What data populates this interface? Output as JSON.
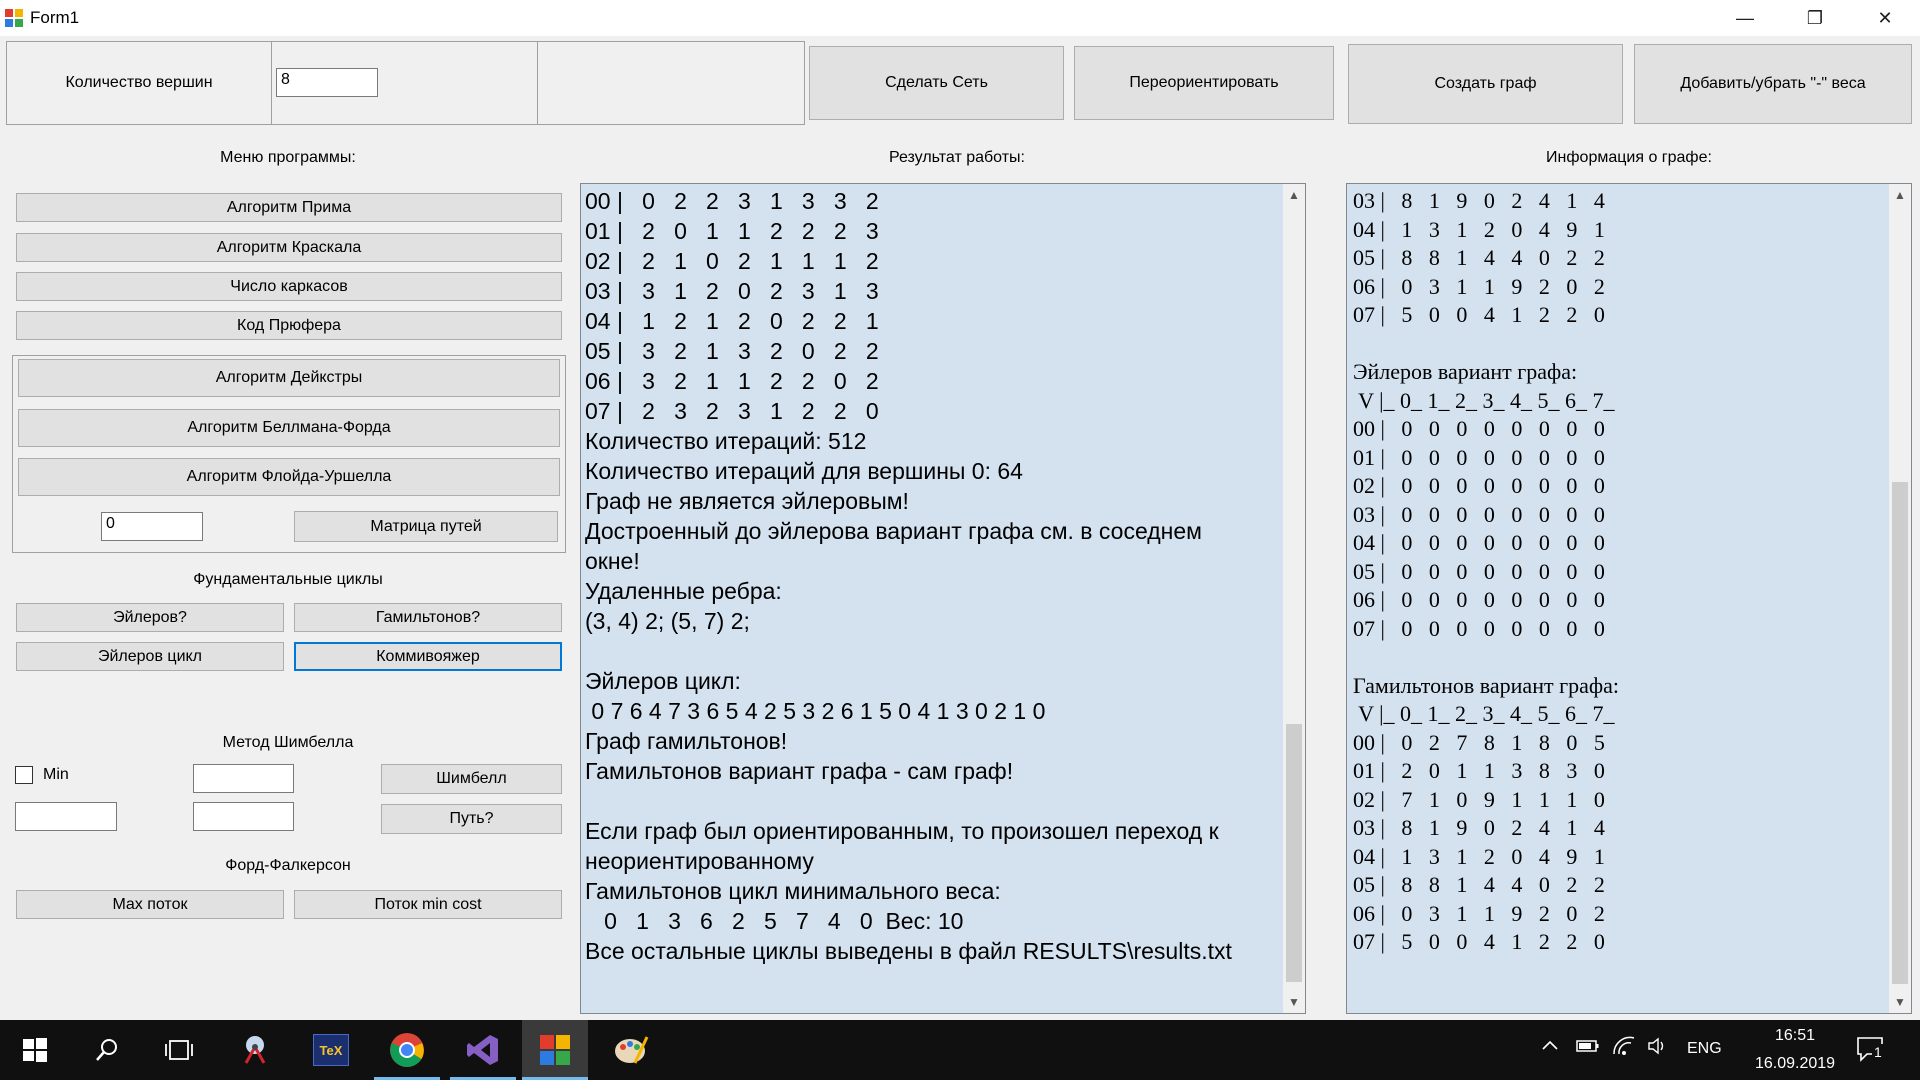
{
  "window": {
    "title": "Form1",
    "minimize": "—",
    "restore": "❐",
    "close": "✕"
  },
  "top": {
    "vertex_count_label": "Количество вершин",
    "vertex_count_value": "8",
    "make_network": "Сделать Сеть",
    "reorient": "Переориентировать",
    "create_graph": "Создать граф",
    "toggle_weights": "Добавить/убрать \"-\" веса"
  },
  "menu": {
    "title": "Меню программы:",
    "prim": "Алгоритм Прима",
    "kruskal": "Алгоритм Краскала",
    "frames": "Число каркасов",
    "prufer": "Код Прюфера",
    "dijkstra": "Алгоритм Дейкстры",
    "bellman": "Алгоритм Беллмана-Форда",
    "floyd": "Алгоритм Флойда-Уршелла",
    "path_input": "0",
    "path_matrix": "Матрица путей",
    "fund_title": "Фундаментальные циклы",
    "euler_q": "Эйлеров?",
    "hamilton_q": "Гамильтонов?",
    "euler_cycle": "Эйлеров цикл",
    "salesman": "Коммивояжер",
    "shimbel_title": "Метод Шимбелла",
    "min_label": "Min",
    "shimbel": "Шимбелл",
    "path_q": "Путь?",
    "ford_title": "Форд-Фалкерсон",
    "max_flow": "Max поток",
    "min_cost": "Поток min cost"
  },
  "result": {
    "title": "Результат работы:",
    "lines": [
      "00 |   0   2   2   3   1   3   3   2",
      "01 |   2   0   1   1   2   2   2   3",
      "02 |   2   1   0   2   1   1   1   2",
      "03 |   3   1   2   0   2   3   1   3",
      "04 |   1   2   1   2   0   2   2   1",
      "05 |   3   2   1   3   2   0   2   2",
      "06 |   3   2   1   1   2   2   0   2",
      "07 |   2   3   2   3   1   2   2   0",
      "Количество итераций: 512",
      "Количество итераций для вершины 0: 64",
      "Граф не является эйлеровым!",
      "Достроенный до эйлерова вариант графа см. в соседнем",
      "окне!",
      "Удаленные ребра:",
      "(3, 4) 2; (5, 7) 2;",
      "",
      "Эйлеров цикл:",
      " 0 7 6 4 7 3 6 5 4 2 5 3 2 6 1 5 0 4 1 3 0 2 1 0",
      "Граф гамильтонов!",
      "Гамильтонов вариант графа - сам граф!",
      "",
      "Если граф был ориентированным, то произошел переход к",
      "неориентированному",
      "Гамильтонов цикл минимального веса:",
      "   0   1   3   6   2   5   7   4   0  Вес: 10",
      "Все остальные циклы выведены в файл RESULTS\\results.txt"
    ]
  },
  "info": {
    "title": "Информация о графе:",
    "lines": [
      "03 |   8   1   9   0   2   4   1   4",
      "04 |   1   3   1   2   0   4   9   1",
      "05 |   8   8   1   4   4   0   2   2",
      "06 |   0   3   1   1   9   2   0   2",
      "07 |   5   0   0   4   1   2   2   0",
      "",
      "Эйлеров вариант графа:",
      " V |_ 0_ 1_ 2_ 3_ 4_ 5_ 6_ 7_",
      "00 |   0   0   0   0   0   0   0   0",
      "01 |   0   0   0   0   0   0   0   0",
      "02 |   0   0   0   0   0   0   0   0",
      "03 |   0   0   0   0   0   0   0   0",
      "04 |   0   0   0   0   0   0   0   0",
      "05 |   0   0   0   0   0   0   0   0",
      "06 |   0   0   0   0   0   0   0   0",
      "07 |   0   0   0   0   0   0   0   0",
      "",
      "Гамильтонов вариант графа:",
      " V |_ 0_ 1_ 2_ 3_ 4_ 5_ 6_ 7_",
      "00 |   0   2   7   8   1   8   0   5",
      "01 |   2   0   1   1   3   8   3   0",
      "02 |   7   1   0   9   1   1   1   0",
      "03 |   8   1   9   0   2   4   1   4",
      "04 |   1   3   1   2   0   4   9   1",
      "05 |   8   8   1   4   4   0   2   2",
      "06 |   0   3   1   1   9   2   0   2",
      "07 |   5   0   0   4   1   2   2   0"
    ]
  },
  "taskbar": {
    "lang": "ENG",
    "time": "16:51",
    "date": "16.09.2019",
    "notifications": "1",
    "tex_label": "TeX"
  }
}
